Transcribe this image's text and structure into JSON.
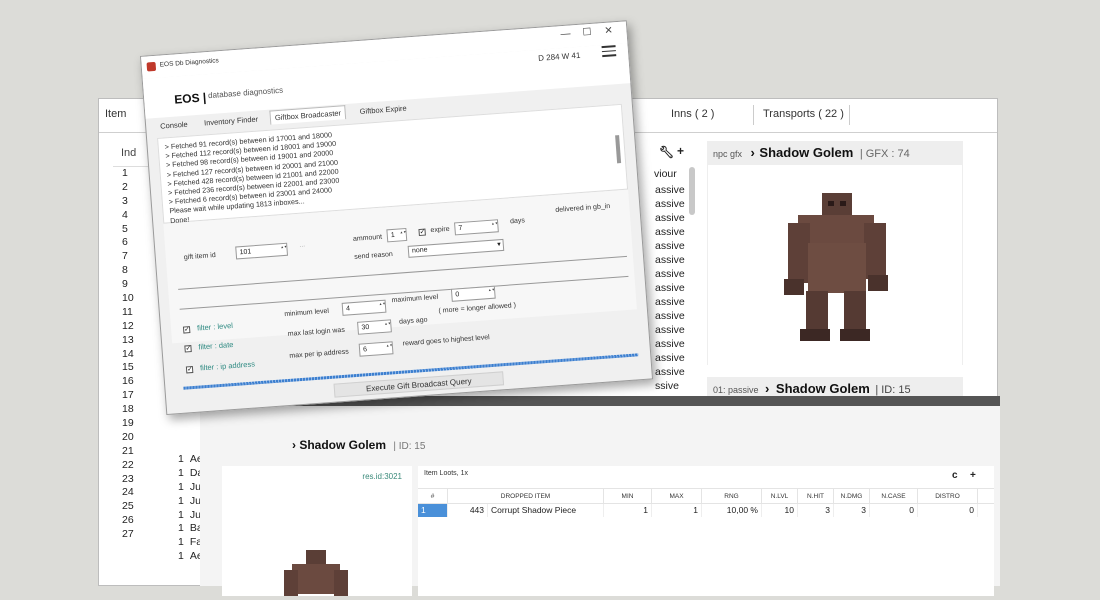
{
  "main": {
    "tabs": [
      {
        "label": "Item"
      },
      {
        "label": "Inns ( 2 )"
      },
      {
        "label": "Transports ( 22 )"
      }
    ],
    "index_header": "Ind",
    "index_rows": [
      "1",
      "2",
      "3",
      "4",
      "5",
      "6",
      "7",
      "8",
      "9",
      "10",
      "11",
      "12",
      "13",
      "14",
      "15",
      "16",
      "17",
      "18",
      "19",
      "20",
      "21",
      "22",
      "23",
      "24",
      "25",
      "26",
      "27"
    ],
    "lower_rows": [
      {
        "n": "1",
        "name": "Ae"
      },
      {
        "n": "1",
        "name": "Da"
      },
      {
        "n": "1",
        "name": "Ju"
      },
      {
        "n": "1",
        "name": "Ju"
      },
      {
        "n": "1",
        "name": "Ju"
      },
      {
        "n": "1",
        "name": "Ba"
      },
      {
        "n": "1",
        "name": "Fa"
      },
      {
        "n": "1",
        "name": "Ae"
      }
    ],
    "behaviour_header": "viour",
    "behaviour_rows": [
      "assive",
      "assive",
      "assive",
      "assive",
      "assive",
      "assive",
      "assive",
      "assive",
      "assive",
      "assive",
      "assive",
      "assive",
      "assive",
      "assive",
      "ssive"
    ],
    "npc_panel": {
      "label": "npc gfx",
      "name": "Shadow Golem",
      "gfx": "| GFX : 74"
    },
    "npc_panel2": {
      "label": "01: passive",
      "name": "Shadow Golem",
      "id": "| ID: 15"
    }
  },
  "loot": {
    "title": "Shadow Golem",
    "id": "| ID: 15",
    "res_id": "res.id:3021",
    "caption": "Item Loots, 1x",
    "columns": [
      "#",
      "DROPPED ITEM",
      "MIN",
      "MAX",
      "RNG",
      "N.LVL",
      "N.HIT",
      "N.DMG",
      "N.CASE",
      "DISTRO"
    ],
    "row": {
      "num": "1",
      "item_id": "443",
      "item_name": "Corrupt Shadow Piece",
      "min": "1",
      "max": "1",
      "rng": "10,00 %",
      "nlvl": "10",
      "nhit": "3",
      "ndmg": "3",
      "ncase": "0",
      "distro": "0"
    }
  },
  "dialog": {
    "window_title": "EOS Db Diagnostics",
    "brand": "EOS |",
    "brand_sub": "database diagnostics",
    "stats": "D 284 W 41",
    "tabs": [
      "Console",
      "Inventory Finder",
      "Giftbox Broadcaster",
      "Giftbox Expire"
    ],
    "console_lines": [
      "> Fetched 91 record(s) between id 17001 and 18000",
      "> Fetched 112 record(s) between id 18001 and 19000",
      "> Fetched 98 record(s) between id 19001 and 20000",
      "> Fetched 127 record(s) between id 20001 and 21000",
      "> Fetched 428 record(s) between id 21001 and 22000",
      "> Fetched 236 record(s) between id 22001 and 23000",
      "> Fetched 6 record(s) between id 23001 and 24000",
      "Please wait while updating 1813 inboxes...",
      "Done!"
    ],
    "form": {
      "gift_item_label": "gift item id",
      "gift_item_value": "101",
      "browse_label": "...",
      "amount_label": "ammount",
      "amount_value": "1",
      "expire_label": "expire",
      "expire_value": "7",
      "days_label": "days",
      "delivered_label": "delivered in gb_in",
      "send_reason_label": "send reason",
      "send_reason_value": "none",
      "filter_level": "filter : level",
      "filter_date": "filter : date",
      "filter_ip": "filter : ip address",
      "min_level_label": "minimum level",
      "min_level_value": "4",
      "max_level_label": "maximum level",
      "max_level_value": "0",
      "more_longer": "( more = longer allowed )",
      "last_login_label": "max last login was",
      "last_login_value": "30",
      "days_ago": "days ago",
      "max_per_ip_label": "max per ip address",
      "max_per_ip_value": "6",
      "reward_note": "reward goes to highest level"
    },
    "execute_label": "Execute Gift Broadcast Query"
  }
}
